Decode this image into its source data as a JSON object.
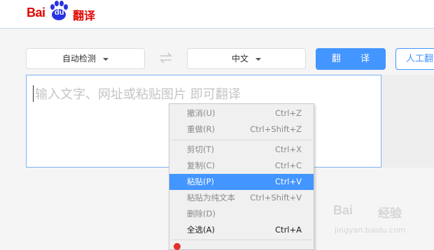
{
  "brand": {
    "logo_text": "Bai",
    "logo_du": "du",
    "product": "翻译"
  },
  "toolbar": {
    "source_lang": "自动检测",
    "target_lang": "中文",
    "translate_label": "翻 译",
    "human_label": "人工翻译"
  },
  "input": {
    "placeholder": "输入文字、网址或粘贴图片 即可翻译"
  },
  "context_menu": {
    "items": [
      {
        "label": "撤消(U)",
        "shortcut": "Ctrl+Z",
        "enabled": false
      },
      {
        "label": "重做(R)",
        "shortcut": "Ctrl+Shift+Z",
        "enabled": false
      },
      {
        "label": "剪切(T)",
        "shortcut": "Ctrl+X",
        "enabled": false
      },
      {
        "label": "复制(C)",
        "shortcut": "Ctrl+C",
        "enabled": false
      },
      {
        "label": "粘贴(P)",
        "shortcut": "Ctrl+V",
        "enabled": true,
        "highlighted": true
      },
      {
        "label": "粘贴为纯文本",
        "shortcut": "Ctrl+Shift+V",
        "enabled": false
      },
      {
        "label": "删除(D)",
        "shortcut": "",
        "enabled": false
      },
      {
        "label": "全选(A)",
        "shortcut": "Ctrl+A",
        "enabled": true
      }
    ]
  },
  "watermark": {
    "logo": "Bai",
    "cn": "经验",
    "url": "jingyan.baidu.com"
  },
  "colors": {
    "brand_red": "#e10602",
    "accent_blue": "#4395ff",
    "highlight": "#4395ff"
  }
}
